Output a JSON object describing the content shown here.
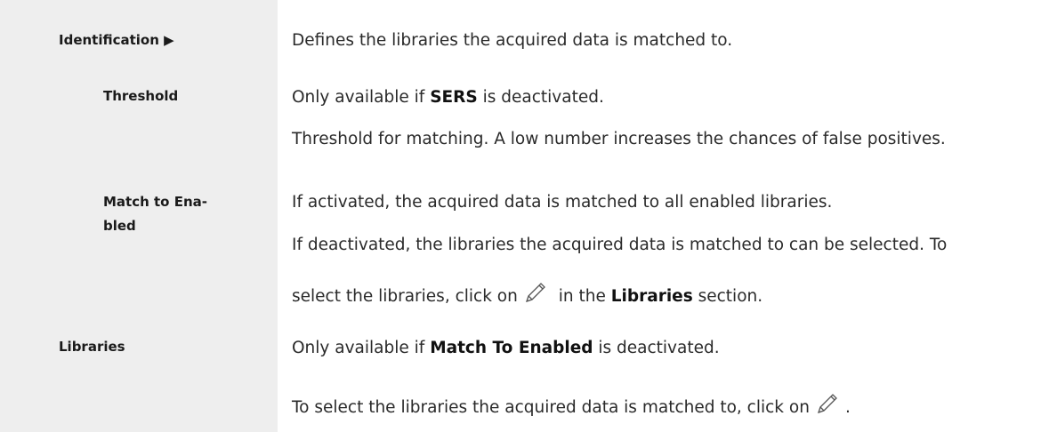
{
  "rows": {
    "identification": {
      "term": "Identification ▶",
      "desc": "Defines the libraries the acquired data is matched to."
    },
    "threshold": {
      "term": "Threshold",
      "line1_pre": "Only available if ",
      "line1_bold": "SERS",
      "line1_post": " is deactivated.",
      "line2": "Threshold for matching. A low number increases the chances of false positives."
    },
    "match_to_enabled": {
      "term_line1": "Match to Ena-",
      "term_line2": "bled",
      "line1": "If activated, the acquired data is matched to all enabled libraries.",
      "line2": "If deactivated, the libraries the acquired data is matched to can be selected. To",
      "line3_pre": "select the libraries, click on",
      "line3_mid": " in the ",
      "line3_bold": "Libraries",
      "line3_post": " section."
    },
    "libraries": {
      "term": "Libraries",
      "line1_pre": "Only available if ",
      "line1_bold": "Match To Enabled",
      "line1_post": " is deactivated.",
      "line2_pre": "To select the libraries the acquired data is matched to, click on",
      "line2_post": "."
    }
  },
  "icons": {
    "edit": "pencil-icon"
  },
  "colors": {
    "sidebar_bg": "#eeeeee"
  }
}
